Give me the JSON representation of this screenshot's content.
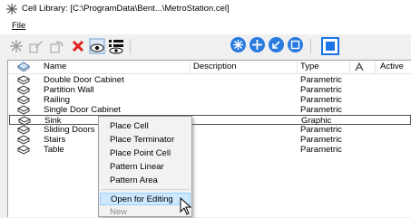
{
  "window": {
    "title": "Cell Library: [C:\\ProgramData\\Bent...\\MetroStation.cel]"
  },
  "menu": {
    "file_label": "File"
  },
  "list": {
    "headers": {
      "name": "Name",
      "description": "Description",
      "type": "Type",
      "active": "Active"
    },
    "rows": [
      {
        "name": "Double Door Cabinet",
        "type": "Parametric"
      },
      {
        "name": "Partition Wall",
        "type": "Parametric"
      },
      {
        "name": "Railing",
        "type": "Parametric"
      },
      {
        "name": "Single Door Cabinet",
        "type": "Parametric"
      },
      {
        "name": "Sink",
        "type": "Graphic"
      },
      {
        "name": "Sliding Doors",
        "type": "Parametric"
      },
      {
        "name": "Stairs",
        "type": "Parametric"
      },
      {
        "name": "Table",
        "type": "Parametric"
      }
    ]
  },
  "context_menu": {
    "items": [
      {
        "label": "Place Cell"
      },
      {
        "label": "Place Terminator"
      },
      {
        "label": "Place Point Cell"
      },
      {
        "label": "Pattern Linear"
      },
      {
        "label": "Pattern Area"
      },
      {
        "label": "Open for Editing"
      },
      {
        "label": "New"
      }
    ]
  },
  "colors": {
    "accent": "#2a7be0",
    "delete": "#e0201c",
    "highlight": "#cce8ff"
  }
}
